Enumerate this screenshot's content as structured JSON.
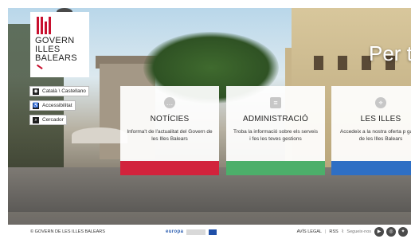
{
  "logo": {
    "line1": "GOVERN",
    "line2": "ILLES",
    "line3": "BALEARS"
  },
  "side_buttons": [
    {
      "label": "Català \\ Castellano",
      "icon": "language-icon"
    },
    {
      "label": "Accessibilitat",
      "icon": "accessibility-icon"
    },
    {
      "label": "Cercador",
      "icon": "search-icon"
    }
  ],
  "headline": "Per t",
  "cards": [
    {
      "title": "NOTÍCIES",
      "desc": "Informa't de l'actualitat del Govern de les Illes Balears",
      "icon": "chat-bubble-icon",
      "bar_color": "#d2233c"
    },
    {
      "title": "ADMINISTRACIÓ",
      "desc": "Troba la informació sobre els serveis i fes les teves gestions",
      "icon": "document-icon",
      "bar_color": "#4caf6a"
    },
    {
      "title": "LES ILLES",
      "desc": "Accedeix a la nostra oferta p gaudir de les Illes Balears",
      "icon": "location-pin-icon",
      "bar_color": "#2e6fc4"
    }
  ],
  "footer": {
    "copyright": "© GOVERN DE LES ILLES BALEARS",
    "europe_label": "europa",
    "legal": "AVÍS LEGAL",
    "rss": "RSS",
    "follow": "Segueix-nos"
  }
}
